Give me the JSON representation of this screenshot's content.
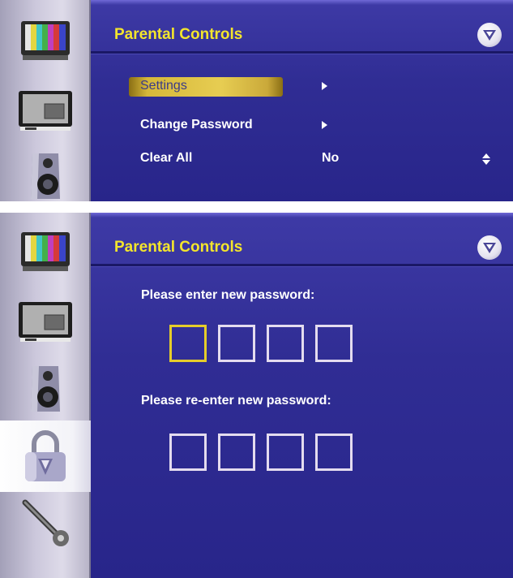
{
  "colors": {
    "panel_bg": "#302d94",
    "title_yellow": "#f3e52c",
    "highlight_gold": "#e7cd52",
    "box_focus": "#e6cd2a",
    "box_border": "#e4dcef"
  },
  "top_screen": {
    "title": "Parental Controls",
    "sidebar_icons": [
      "tv-color-bars-icon",
      "tv-picture-icon",
      "speaker-icon"
    ],
    "menu": [
      {
        "label": "Settings",
        "value": "",
        "control": "arrow-right-icon",
        "selected": true
      },
      {
        "label": "Change Password",
        "value": "",
        "control": "arrow-right-icon",
        "selected": false
      },
      {
        "label": "Clear All",
        "value": "No",
        "control": "up-down-arrow-icon",
        "selected": false
      }
    ]
  },
  "bottom_screen": {
    "title": "Parental Controls",
    "sidebar_icons": [
      "tv-color-bars-icon",
      "tv-picture-icon",
      "speaker-icon",
      "padlock-icon",
      "wrench-icon"
    ],
    "prompt_new": "Please enter new password:",
    "prompt_reenter": "Please re-enter new password:",
    "digits_per_password": 4,
    "focused_digit": 1
  }
}
